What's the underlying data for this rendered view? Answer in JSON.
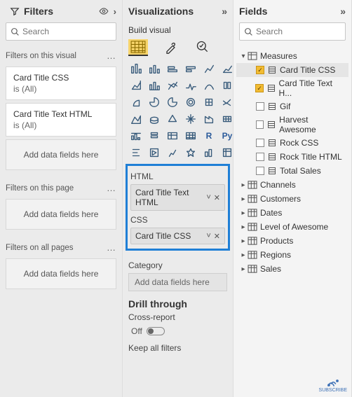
{
  "filters": {
    "title": "Filters",
    "search_placeholder": "Search",
    "on_visual": {
      "title": "Filters on this visual",
      "cards": [
        {
          "name": "Card Title CSS",
          "state": "is (All)"
        },
        {
          "name": "Card Title Text HTML",
          "state": "is (All)"
        }
      ],
      "drop": "Add data fields here"
    },
    "on_page": {
      "title": "Filters on this page",
      "drop": "Add data fields here"
    },
    "on_all": {
      "title": "Filters on all pages",
      "drop": "Add data fields here"
    }
  },
  "viz": {
    "title": "Visualizations",
    "build": "Build visual",
    "wells": {
      "html": {
        "label": "HTML",
        "field": "Card Title Text HTML"
      },
      "css": {
        "label": "CSS",
        "field": "Card Title CSS"
      },
      "category": {
        "label": "Category",
        "drop": "Add data fields here"
      }
    },
    "drill": {
      "title": "Drill through",
      "cross": "Cross-report",
      "off": "Off",
      "keep": "Keep all filters"
    }
  },
  "fields": {
    "title": "Fields",
    "search_placeholder": "Search",
    "measures_label": "Measures",
    "measures": [
      {
        "label": "Card Title CSS",
        "checked": true,
        "selected": true
      },
      {
        "label": "Card Title Text H...",
        "checked": true
      },
      {
        "label": "Gif",
        "checked": false
      },
      {
        "label": "Harvest Awesome",
        "checked": false
      },
      {
        "label": "Rock CSS",
        "checked": false
      },
      {
        "label": "Rock Title HTML",
        "checked": false
      },
      {
        "label": "Total Sales",
        "checked": false
      }
    ],
    "tables": [
      "Channels",
      "Customers",
      "Dates",
      "Level of Awesome",
      "Products",
      "Regions",
      "Sales"
    ]
  },
  "subscribe": "SUBSCRIBE"
}
